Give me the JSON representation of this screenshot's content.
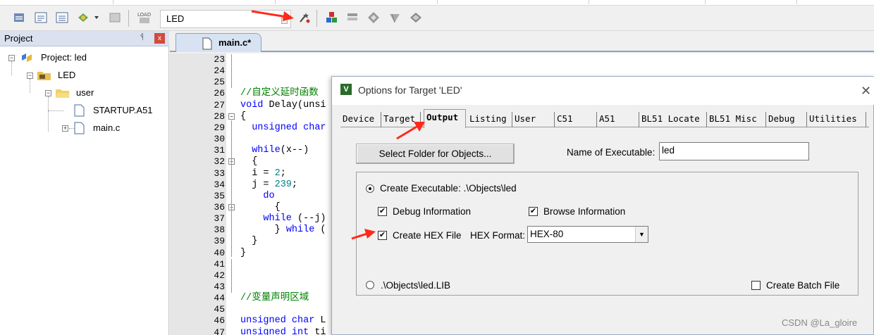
{
  "toolbar": {
    "target_name": "LED",
    "icons": [
      "translate-icon",
      "build-icon",
      "rebuild-icon",
      "batch-build-icon",
      "stop-build-icon",
      "download-icon",
      "target-options-icon",
      "file-extensions-icon",
      "manage-components-icon",
      "select-device-icon",
      "pack-installer-icon",
      "options-icon"
    ]
  },
  "project_panel": {
    "title": "Project",
    "pin": "ᛩ",
    "close": "x",
    "tree": {
      "root": "Project: led",
      "target": "LED",
      "group": "user",
      "files": [
        "STARTUP.A51",
        "main.c"
      ]
    }
  },
  "editor": {
    "tab_label": "main.c*",
    "lines": [
      {
        "n": "23",
        "text": ""
      },
      {
        "n": "24",
        "text": ""
      },
      {
        "n": "25",
        "text": ""
      },
      {
        "n": "26",
        "text": "//自定义延时函数"
      },
      {
        "n": "27",
        "kw": "void",
        "text": " Delay(unsi"
      },
      {
        "n": "28",
        "text": "{"
      },
      {
        "n": "29",
        "kw": "  unsigned char",
        "text": ""
      },
      {
        "n": "30",
        "text": ""
      },
      {
        "n": "31",
        "kw": "  while",
        "text": "(x--)"
      },
      {
        "n": "32",
        "text": "  {"
      },
      {
        "n": "33",
        "text": "  i = ",
        "num": "2",
        "tail": ";"
      },
      {
        "n": "34",
        "text": "  j = ",
        "num": "239",
        "tail": ";"
      },
      {
        "n": "35",
        "kw": "    do",
        "text": ""
      },
      {
        "n": "36",
        "text": "      {"
      },
      {
        "n": "37",
        "kw": "    while",
        "text": " (--j)"
      },
      {
        "n": "38",
        "text": "      } ",
        "kw2": "while",
        "tail": " ("
      },
      {
        "n": "39",
        "text": "  }"
      },
      {
        "n": "40",
        "text": "}"
      },
      {
        "n": "41",
        "text": ""
      },
      {
        "n": "42",
        "text": ""
      },
      {
        "n": "43",
        "text": ""
      },
      {
        "n": "44",
        "text": "//变量声明区域"
      },
      {
        "n": "45",
        "text": ""
      },
      {
        "n": "46",
        "kw": "unsigned char",
        "text": " L"
      },
      {
        "n": "47",
        "kw": "unsigned int",
        "text": " ti"
      }
    ]
  },
  "dialog": {
    "title": "Options for Target 'LED'",
    "close": "✕",
    "tabs": [
      "Device",
      "Target",
      "Output",
      "Listing",
      "User",
      "C51",
      "A51",
      "BL51 Locate",
      "BL51 Misc",
      "Debug",
      "Utilities"
    ],
    "active_tab": "Output",
    "select_folder_button": "Select Folder for Objects...",
    "name_of_executable_label": "Name of Executable:",
    "name_of_executable_value": "led",
    "create_executable_label": "Create Executable:  .\\Objects\\led",
    "create_executable_selected": true,
    "debug_information_label": "Debug Information",
    "debug_information_checked": true,
    "browse_information_label": "Browse Information",
    "browse_information_checked": true,
    "create_hex_label": "Create HEX File",
    "create_hex_checked": true,
    "hex_format_label": "HEX Format:",
    "hex_format_value": "HEX-80",
    "create_library_label": ".\\Objects\\led.LIB",
    "create_library_selected": false,
    "create_batch_label": "Create Batch File",
    "create_batch_checked": false
  },
  "watermark": "CSDN @La_gloire",
  "colors": {
    "keyword": "#0000ff",
    "comment": "#008000",
    "number": "#008080",
    "arrow": "#ff2a1a"
  }
}
